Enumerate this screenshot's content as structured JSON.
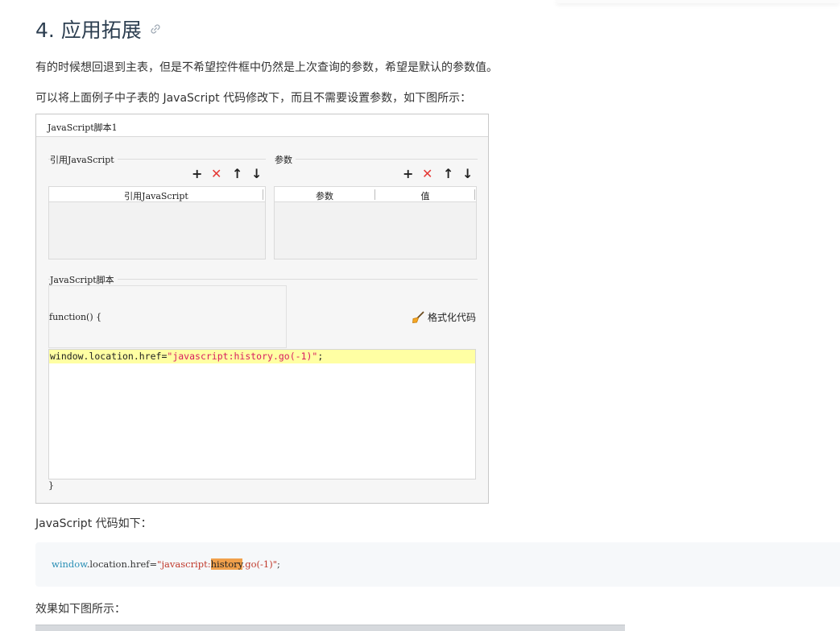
{
  "heading": {
    "text": "4. 应用拓展",
    "anchor_icon": "link-icon"
  },
  "paragraphs": {
    "p1": "有的时候想回退到主表，但是不希望控件框中仍然是上次查询的参数，希望是默认的参数值。",
    "p2": "可以将上面例子中子表的 JavaScript 代码修改下，而且不需要设置参数，如下图所示：",
    "p3": "JavaScript 代码如下：",
    "p4": "效果如下图所示："
  },
  "figure": {
    "title": "JavaScript脚本1",
    "ref_section": {
      "label": "引用JavaScript",
      "column": "引用JavaScript",
      "tools": [
        "+",
        "✕",
        "↑",
        "↓"
      ]
    },
    "param_section": {
      "label": "参数",
      "columns": [
        "参数",
        "值"
      ],
      "tools": [
        "+",
        "✕",
        "↑",
        "↓"
      ]
    },
    "script_section": {
      "label": "JavaScript脚本",
      "function_header": "function() {",
      "format_button": "格式化代码",
      "code_prefix": "window.location.href=",
      "code_string": "\"javascript:history.go(-1)\"",
      "code_suffix": ";",
      "closing": "}"
    }
  },
  "code_block": {
    "kw": "window",
    "mid": ".location.href=",
    "str_start": "\"javascript:",
    "highlight": "history",
    "str_end": ".go(-1)\"",
    "end": ";"
  },
  "colors": {
    "accent_red": "#e53935",
    "code_highlight": "#ffffa3",
    "search_highlight": "#f0a04b"
  }
}
